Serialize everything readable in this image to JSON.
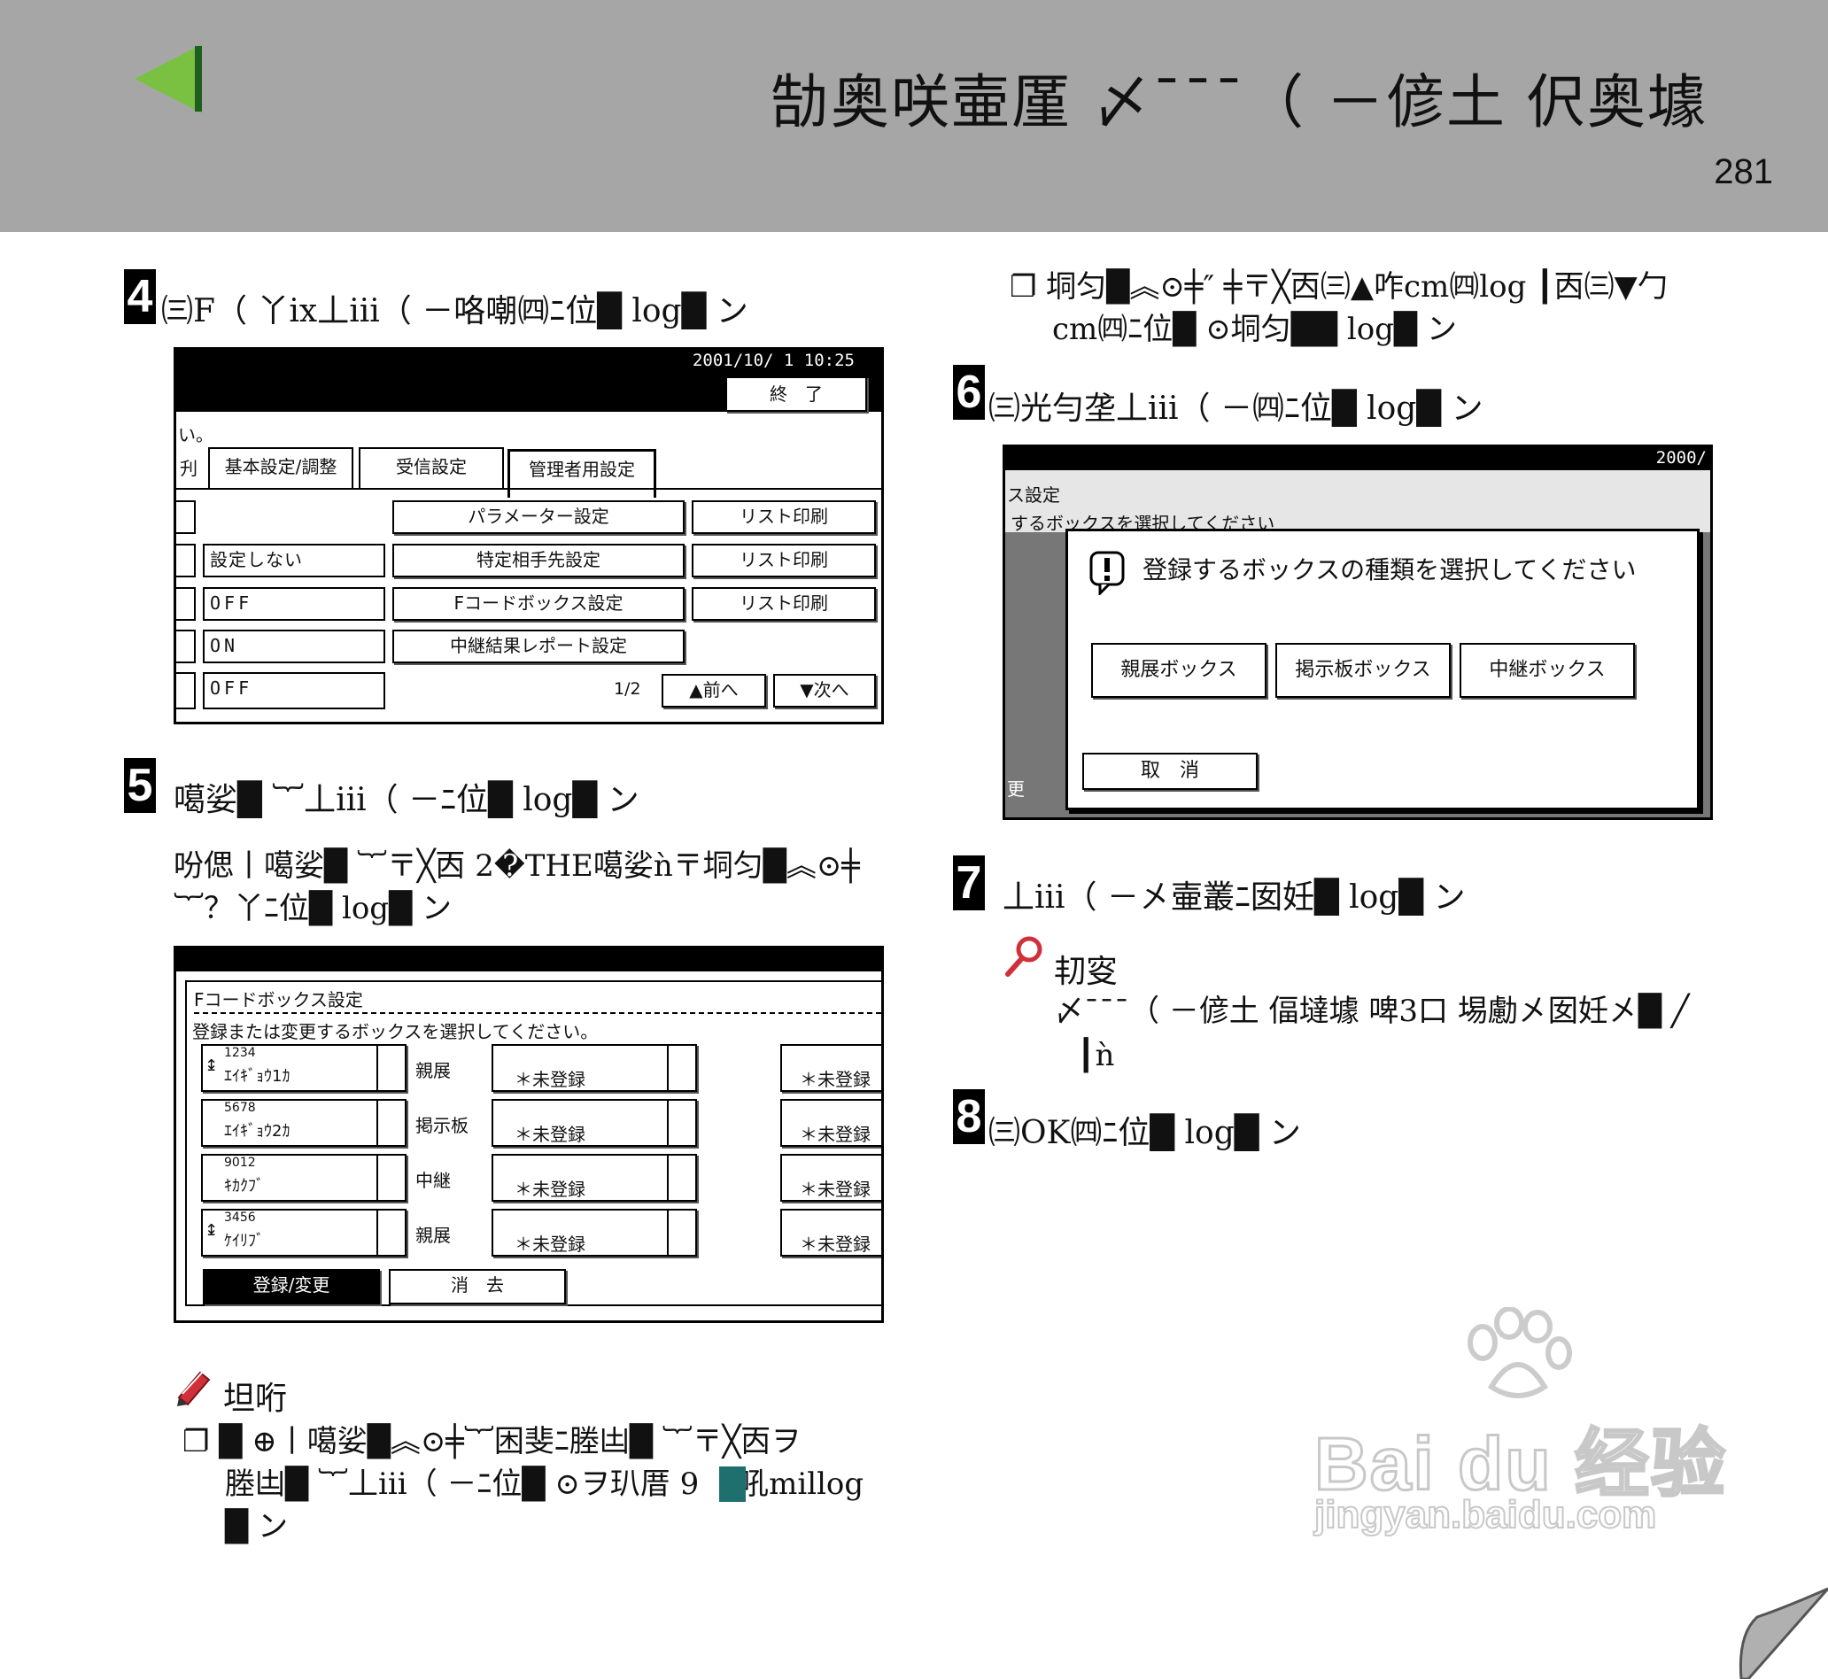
{
  "header": {
    "title": "勂奥咲壷厪 〆¯¯¯（ －偐土 伬奥壉",
    "page_number": "281"
  },
  "left": {
    "step4": {
      "number": "4",
      "text": "㈢F（ 丫ix丄iii（ －咯嘲㈣ﾆ位█ log█ ン",
      "screen": {
        "datetime": "2001/10/ 1   10:25",
        "end_button": "終　了",
        "message_fragment": "い。",
        "tab_cut": "刋",
        "tabs": [
          "基本設定/調整",
          "受信設定",
          "管理者用設定"
        ],
        "rows": [
          {
            "value": "",
            "middle_button": "パラメーター設定",
            "right_button": "リスト印刷"
          },
          {
            "value": "設定しない",
            "middle_button": "特定相手先設定",
            "right_button": "リスト印刷"
          },
          {
            "value": "OFF",
            "middle_button": "Fコードボックス設定",
            "right_button": "リスト印刷"
          },
          {
            "value": "ON",
            "middle_button": "中継結果レポート設定",
            "right_button": ""
          },
          {
            "value": "OFF",
            "middle_button": "",
            "right_button": ""
          }
        ],
        "page_indicator": "1/2",
        "prev_button": "▲前へ",
        "next_button": "▼次へ"
      }
    },
    "step5": {
      "number": "5",
      "text": "噶娑█ ︸丄iii（ －ﾆ位█ log█ ン",
      "body_line1": "吩偲丨噶娑█ ︸〒╳㐁 2�THE噶娑ǹ〒垌匀█︽⊙╪",
      "body_line2": "︸？丫ﾆ位█ log█ ン",
      "screen": {
        "title": "Fコードボックス設定",
        "instruction": "登録または変更するボックスを選択してください。",
        "rows": [
          {
            "code": "1234",
            "name": "ｴｲｷﾞｮｳ1ｶ",
            "type": "親展",
            "box2": "＊未登録",
            "box3": "＊未登録"
          },
          {
            "code": "5678",
            "name": "ｴｲｷﾞｮｳ2ｶ",
            "type": "掲示板",
            "box2": "＊未登録",
            "box3": "＊未登録"
          },
          {
            "code": "9012",
            "name": "ｷｶｸﾌﾞ",
            "type": "中継",
            "box2": "＊未登録",
            "box3": "＊未登録"
          },
          {
            "code": "3456",
            "name": "ｹｲﾘﾌﾞ",
            "type": "親展",
            "box2": "＊未登録",
            "box3": "＊未登録"
          }
        ],
        "register_button": "登録/変更",
        "delete_button": "消　去"
      }
    },
    "note": {
      "label": "坦哘",
      "line1": "❐ █ ⊕丨噶娑█︽⊙╪︸困斐ﾆ塍凷█ ︸〒╳㐁ヲ",
      "line2": "塍凷█ ︸丄iii（ －ﾆ位█ ⊙ヲ玐厝 9 丨吼millog",
      "line3": "█ ン"
    }
  },
  "right": {
    "note_top_line1": "❐ 垌匀█︽⊙╪″ ╪〒╳㐁㈢▲咋cm㈣log ┃㐁㈢▼勹",
    "note_top_line2": "cm㈣ﾆ位█ ⊙垌匀██ log█ ン",
    "step6": {
      "number": "6",
      "text": "㈢光勻垄丄iii（ －㈣ﾆ位█ log█ ン",
      "screen": {
        "datetime": "2000/",
        "title_fragment": "ス設定",
        "instruction_fragment": "するボックスを選択してください",
        "dialog_message": "登録するボックスの種類を選択してください",
        "buttons": [
          "親展ボックス",
          "掲示板ボックス",
          "中継ボックス"
        ],
        "cancel_button": "取　消",
        "side_fragment": "更"
      }
    },
    "step7": {
      "number": "7",
      "text": "丄iii（ －㐅壷叢ﾆ囡妊█ log█ ン",
      "ref_label": "㓞叜",
      "ref_line1": "〆¯¯¯（ －偐土 偪墶壉 啤3口 埸勴㐅囡妊㐅█ ╱",
      "ref_line2": "┃ǹ"
    },
    "step8": {
      "number": "8",
      "text": "㈢OK㈣ﾆ位█ log█ ン"
    }
  },
  "watermark": {
    "brand": "Bai du 经验",
    "url": "jingyan.baidu.com"
  },
  "colors": {
    "header_bg": "#a6a6a6",
    "arrow_green": "#7ac142",
    "arrow_dark": "#2e7d32",
    "note_icon_red": "#d0303a",
    "badge_teal": "#1f6f6f"
  }
}
